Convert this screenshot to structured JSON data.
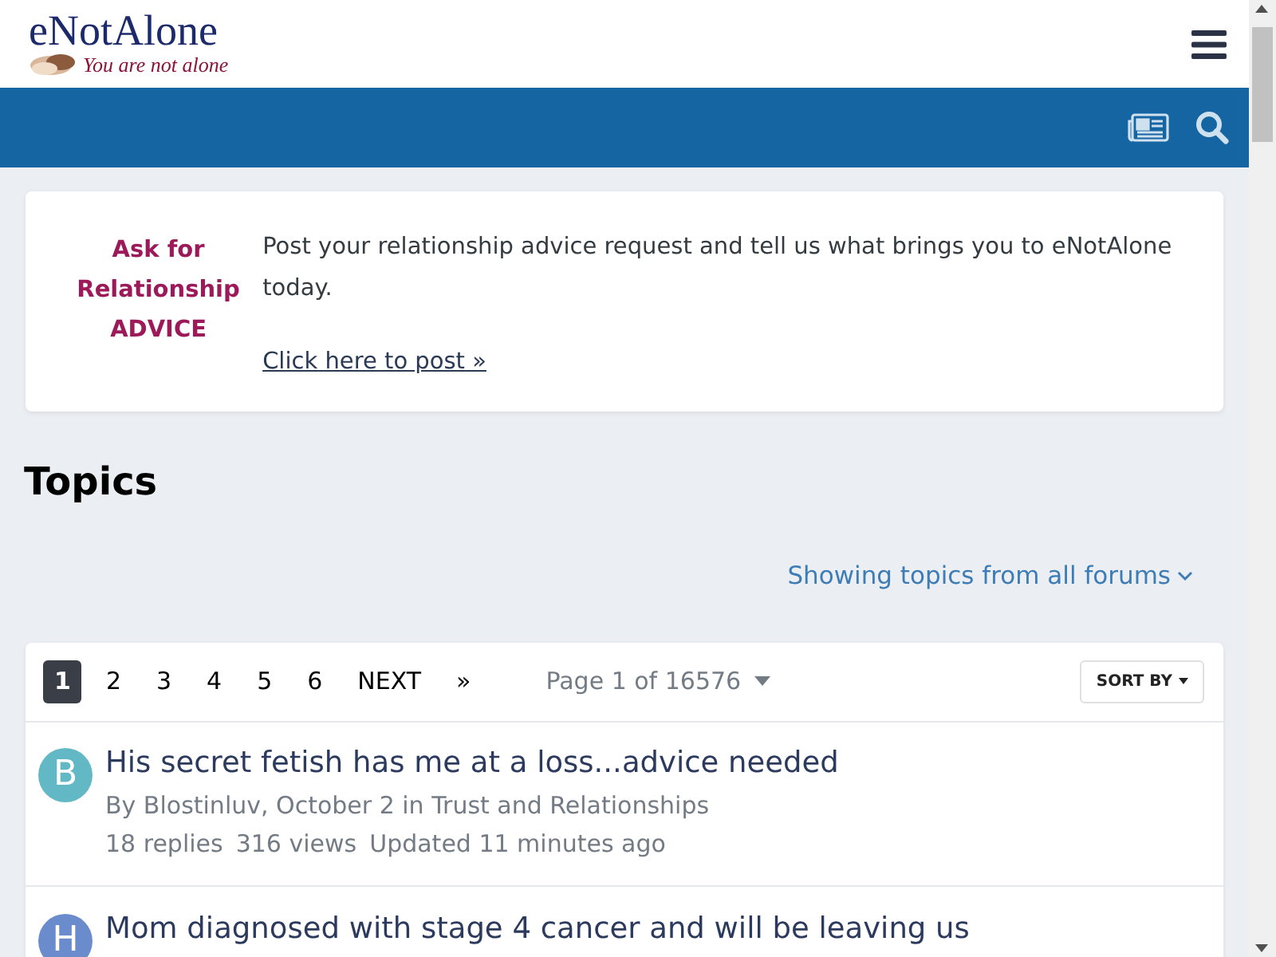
{
  "header": {
    "logo_title": "eNotAlone",
    "logo_tagline": "You are not alone"
  },
  "advice_box": {
    "heading": [
      "Ask for",
      "Relationship",
      "ADVICE"
    ],
    "text": "Post your relationship advice request and tell us what brings you to eNotAlone today.",
    "link": "Click here to post »"
  },
  "page_title": "Topics",
  "filter": "Showing topics from all forums",
  "pagination": {
    "pages": [
      {
        "label": "1",
        "selected": true
      },
      {
        "label": "2",
        "selected": false
      },
      {
        "label": "3",
        "selected": false
      },
      {
        "label": "4",
        "selected": false
      },
      {
        "label": "5",
        "selected": false
      },
      {
        "label": "6",
        "selected": false
      }
    ],
    "next": "NEXT",
    "last": "»",
    "page_info": "Page 1 of 16576",
    "sort": "SORT BY"
  },
  "topics": [
    {
      "avatar": "B",
      "color": "#62b8c4",
      "title": "His secret fetish has me at a loss...advice needed",
      "meta": "By Blostinluv, October 2 in Trust and Relationships",
      "stats": [
        "18 replies",
        "316 views",
        "Updated 11 minutes ago"
      ]
    },
    {
      "avatar": "H",
      "color": "#6a8ccc",
      "title": "Mom diagnosed with stage 4 cancer and will be leaving us"
    }
  ]
}
